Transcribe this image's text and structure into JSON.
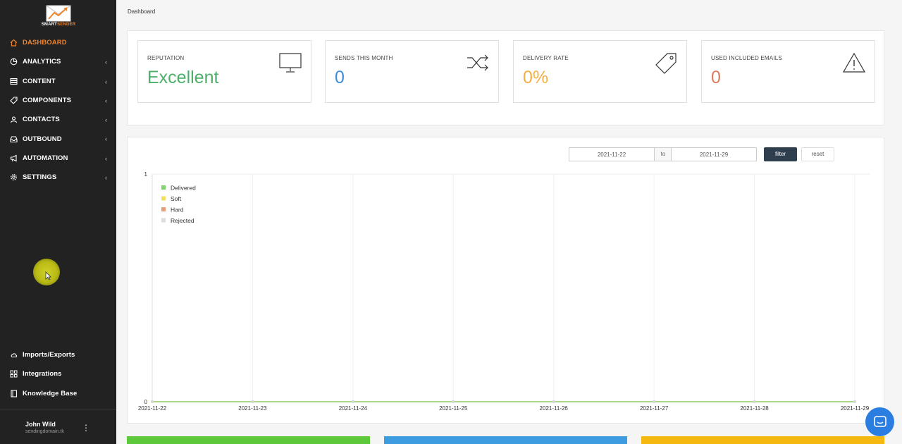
{
  "brand": {
    "name_part1": "SMART",
    "name_part2": "SENDER",
    "accent": "#f0842c"
  },
  "sidebar": {
    "items": [
      {
        "label": "DASHBOARD",
        "icon": "home-icon",
        "active": true
      },
      {
        "label": "ANALYTICS",
        "icon": "pie-chart-icon"
      },
      {
        "label": "CONTENT",
        "icon": "list-icon"
      },
      {
        "label": "COMPONENTS",
        "icon": "tag-icon"
      },
      {
        "label": "CONTACTS",
        "icon": "contacts-icon"
      },
      {
        "label": "OUTBOUND",
        "icon": "inbox-icon"
      },
      {
        "label": "AUTOMATION",
        "icon": "megaphone-icon"
      },
      {
        "label": "SETTINGS",
        "icon": "gear-icon"
      }
    ],
    "chevron": "‹",
    "bottom_items": [
      {
        "label": "Imports/Exports",
        "icon": "cloud-icon"
      },
      {
        "label": "Integrations",
        "icon": "grid-icon"
      },
      {
        "label": "Knowledge Base",
        "icon": "book-icon"
      }
    ]
  },
  "user": {
    "name": "John Wild",
    "domain": "sendingdomain.tk",
    "menu": "⋮"
  },
  "breadcrumb": "Dashboard",
  "stats": [
    {
      "label": "REPUTATION",
      "value": "Excellent",
      "color": "#4caf6a",
      "icon": "monitor-icon"
    },
    {
      "label": "SENDS THIS MONTH",
      "value": "0",
      "color": "#3c8dd9",
      "icon": "shuffle-icon"
    },
    {
      "label": "DELIVERY RATE",
      "value": "0%",
      "color": "#f5b041",
      "icon": "price-tag-icon"
    },
    {
      "label": "USED INCLUDED EMAILS",
      "value": "0",
      "color": "#e07a5f",
      "icon": "warning-icon"
    }
  ],
  "filter": {
    "from": "2021-11-22",
    "to_label": "to",
    "to": "2021-11-29",
    "filter_label": "filter",
    "reset_label": "reset"
  },
  "chart_data": {
    "type": "line",
    "x": [
      "2021-11-22",
      "2021-11-23",
      "2021-11-24",
      "2021-11-25",
      "2021-11-26",
      "2021-11-27",
      "2021-11-28",
      "2021-11-29"
    ],
    "ylim": [
      0,
      1
    ],
    "yticks": [
      "0",
      "1"
    ],
    "grid": true,
    "legend_position": "top-left",
    "series": [
      {
        "name": "Delivered",
        "color": "#7ed36b",
        "values": [
          0,
          0,
          0,
          0,
          0,
          0,
          0,
          0
        ]
      },
      {
        "name": "Soft",
        "color": "#f5e05b",
        "values": [
          0,
          0,
          0,
          0,
          0,
          0,
          0,
          0
        ]
      },
      {
        "name": "Hard",
        "color": "#e8a07a",
        "values": [
          0,
          0,
          0,
          0,
          0,
          0,
          0,
          0
        ]
      },
      {
        "name": "Rejected",
        "color": "#dddddd",
        "values": [
          0,
          0,
          0,
          0,
          0,
          0,
          0,
          0
        ]
      }
    ]
  },
  "bottom_cards": [
    {
      "color": "#5cc83a"
    },
    {
      "color": "#3d9be0"
    },
    {
      "color": "#f5b811"
    }
  ],
  "chat": {
    "icon": "chat-icon",
    "color": "#2a7de1"
  }
}
